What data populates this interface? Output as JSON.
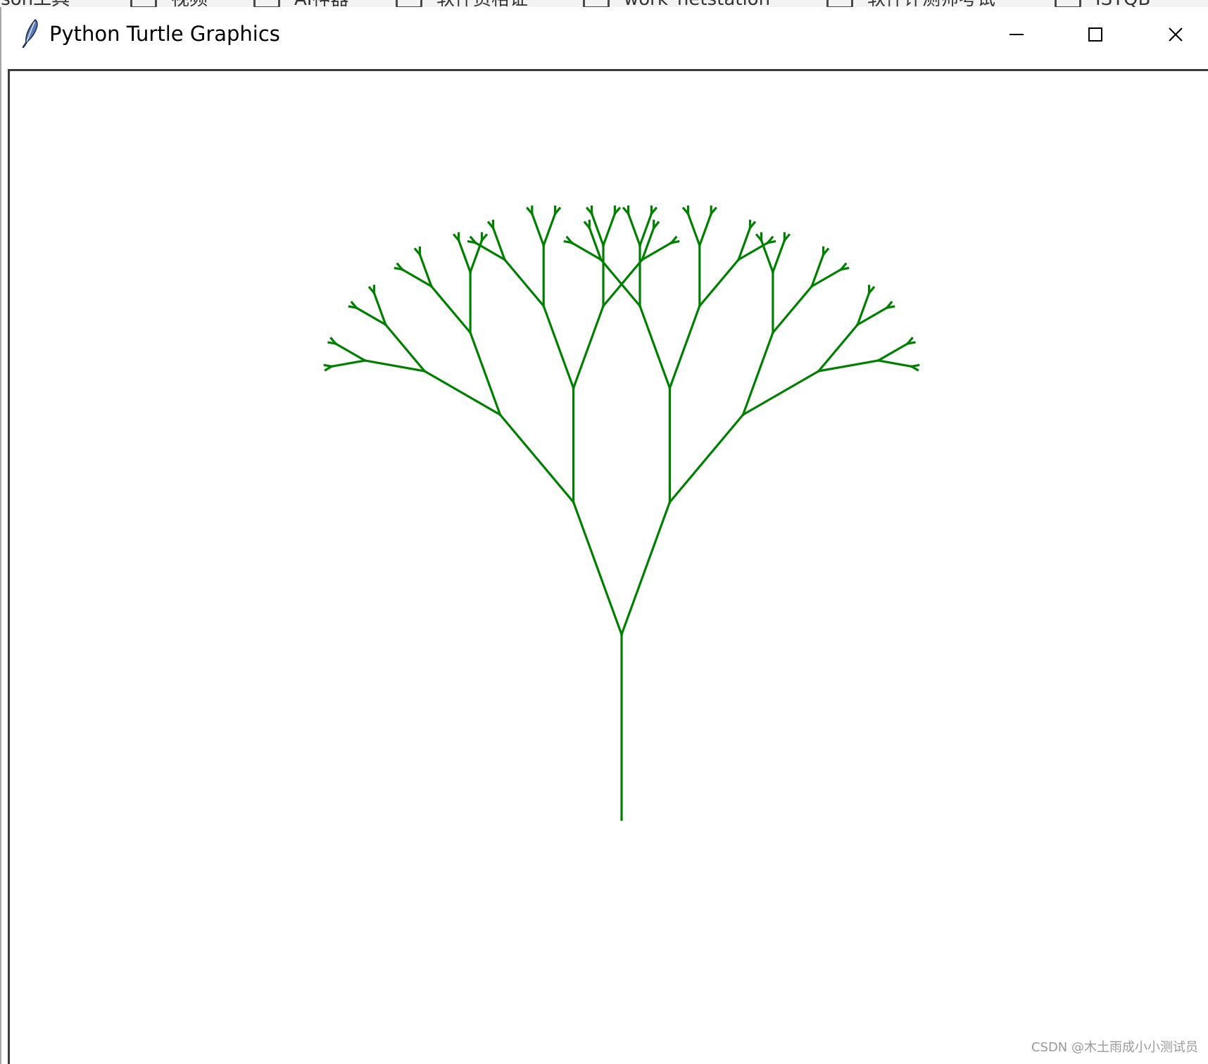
{
  "background_bookmarks": [
    {
      "label": "json工具"
    },
    {
      "label": "视频"
    },
    {
      "label": "AI神器"
    },
    {
      "label": "软件资格证"
    },
    {
      "label": "work_netstation"
    },
    {
      "label": "软件评测师考试"
    },
    {
      "label": "ISTQB"
    }
  ],
  "window": {
    "title": "Python Turtle Graphics",
    "icon": "feather-icon",
    "controls": {
      "minimize_icon": "minimize-icon",
      "maximize_icon": "maximize-icon",
      "close_icon": "close-icon"
    }
  },
  "canvas": {
    "background": "#ffffff",
    "drawing": "recursive fractal tree",
    "pen_color": "#008000",
    "recursion_depth": 6
  },
  "watermark": "CSDN @木土雨成小小测试员"
}
